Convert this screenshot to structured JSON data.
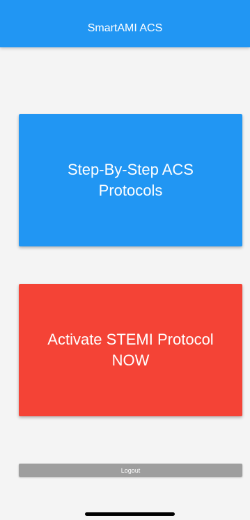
{
  "app_bar": {
    "title": "SmartAMI ACS",
    "color": "#2196f3"
  },
  "cards": {
    "protocols": {
      "label": "Step-By-Step ACS Protocols",
      "color": "#2196f3"
    },
    "stemi": {
      "label": "Activate STEMI Protocol NOW",
      "color": "#f44336"
    }
  },
  "logout": {
    "label": "Logout",
    "color": "#9e9e9e"
  }
}
